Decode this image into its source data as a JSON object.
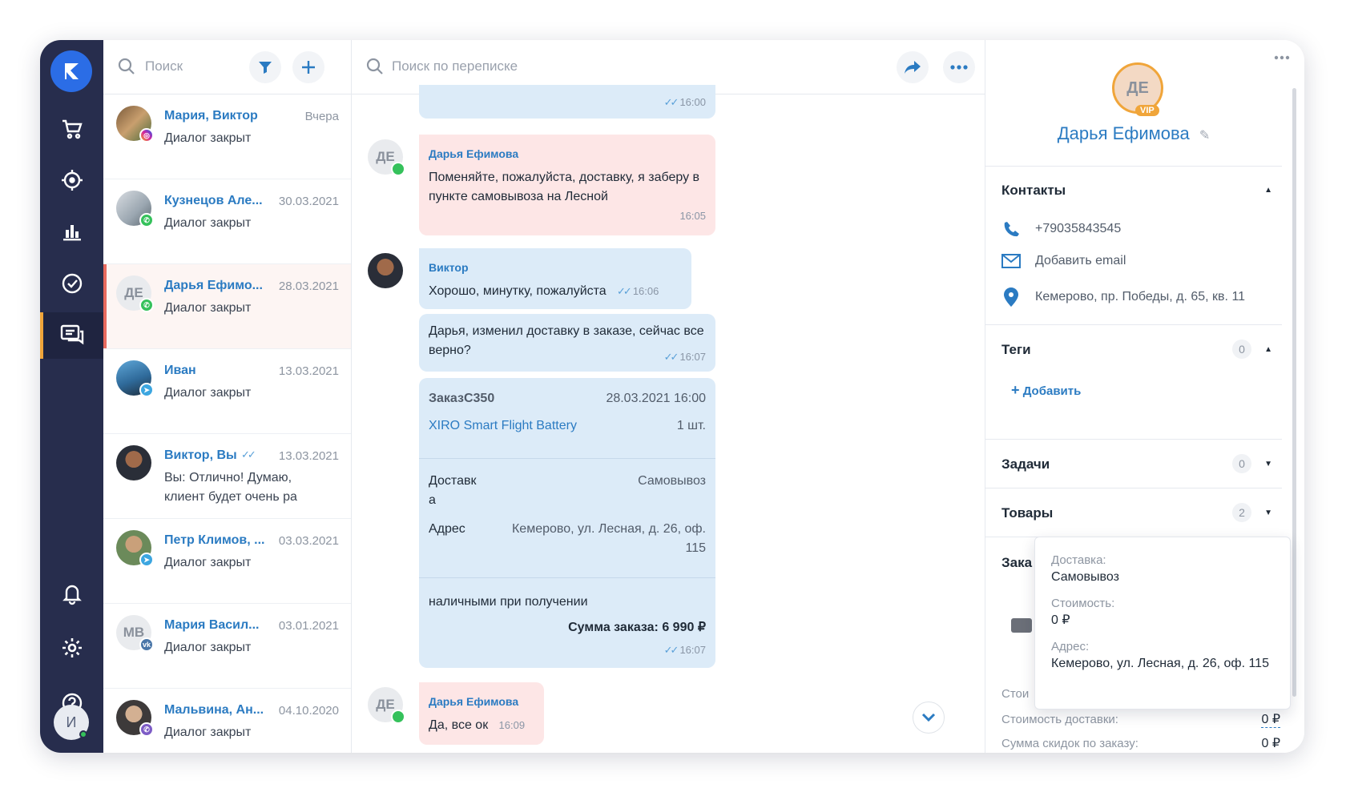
{
  "nav": {
    "me_initial": "И"
  },
  "list": {
    "search_placeholder": "Поиск",
    "dialogs": [
      {
        "name": "Мария, Виктор",
        "date": "Вчера",
        "status": "Диалог закрыт"
      },
      {
        "name": "Кузнецов Але...",
        "date": "30.03.2021",
        "status": "Диалог закрыт"
      },
      {
        "name": "Дарья Ефимо...",
        "date": "28.03.2021",
        "status": "Диалог закрыт",
        "initials": "ДЕ"
      },
      {
        "name": "Иван",
        "date": "13.03.2021",
        "status": "Диалог закрыт"
      },
      {
        "name": "Виктор, Вы",
        "date": "13.03.2021",
        "status": "Вы: Отлично! Думаю, клиент будет очень ра"
      },
      {
        "name": "Петр Климов, ...",
        "date": "03.03.2021",
        "status": "Диалог закрыт"
      },
      {
        "name": "Мария Васил...",
        "date": "03.01.2021",
        "status": "Диалог закрыт",
        "initials": "МВ"
      },
      {
        "name": "Мальвина, Ан...",
        "date": "04.10.2020",
        "status": "Диалог закрыт"
      }
    ]
  },
  "chat": {
    "search_placeholder": "Поиск по переписке",
    "msg0_time": "16:00",
    "msg1": {
      "author": "Дарья Ефимова",
      "text": "Поменяйте, пожалуйста, доставку, я заберу в пункте самовывоза на Лесной",
      "time": "16:05",
      "initials": "ДЕ"
    },
    "msg2": {
      "author": "Виктор",
      "text": "Хорошо, минутку, пожалуйста",
      "time": "16:06"
    },
    "msg3": {
      "text": "Дарья, изменил доставку в заказе, сейчас все верно?",
      "time": "16:07"
    },
    "order": {
      "number": "ЗаказC350",
      "datetime": "28.03.2021 16:00",
      "product": "XIRO Smart Flight Battery",
      "qty": "1 шт.",
      "delivery_label": "Доставк а",
      "delivery_value": "Самовывоз",
      "address_label": "Адрес",
      "address_value": "Кемерово, ул. Лесная, д. 26, оф. 115",
      "payment": "наличными при получении",
      "total": "Сумма заказа: 6 990 ₽",
      "time": "16:07"
    },
    "msg4": {
      "author": "Дарья Ефимова",
      "text": "Да, все ок",
      "time": "16:09",
      "initials": "ДЕ"
    }
  },
  "profile": {
    "initials": "ДЕ",
    "vip": "VIP",
    "name": "Дарья Ефимова",
    "contacts_title": "Контакты",
    "phone": "+79035843545",
    "email_add": "Добавить email",
    "address": "Кемерово, пр. Победы, д. 65, кв. 11",
    "tags_title": "Теги",
    "tags_count": "0",
    "tags_add": "Добавить",
    "tasks_title": "Задачи",
    "tasks_count": "0",
    "goods_title": "Товары",
    "goods_count": "2",
    "orders_title_partial": "Зака",
    "cost_partial": "Стои",
    "delivery_cost_label": "Стоимость доставки:",
    "delivery_cost_value": "0 ₽",
    "discount_label": "Сумма скидок по заказу:",
    "discount_value": "0 ₽"
  },
  "tooltip": {
    "delivery_label": "Доставка:",
    "delivery_value": "Самовывоз",
    "cost_label": "Стоимость:",
    "cost_value": "0 ₽",
    "address_label": "Адрес:",
    "address_value": "Кемерово, ул. Лесная, д. 26, оф. 115"
  },
  "colors": {
    "nav": "#272d4d",
    "accent": "#2b7bc2",
    "incoming": "#fde6e6",
    "outgoing": "#dcebf8",
    "active_marker": "#f0a53a"
  }
}
